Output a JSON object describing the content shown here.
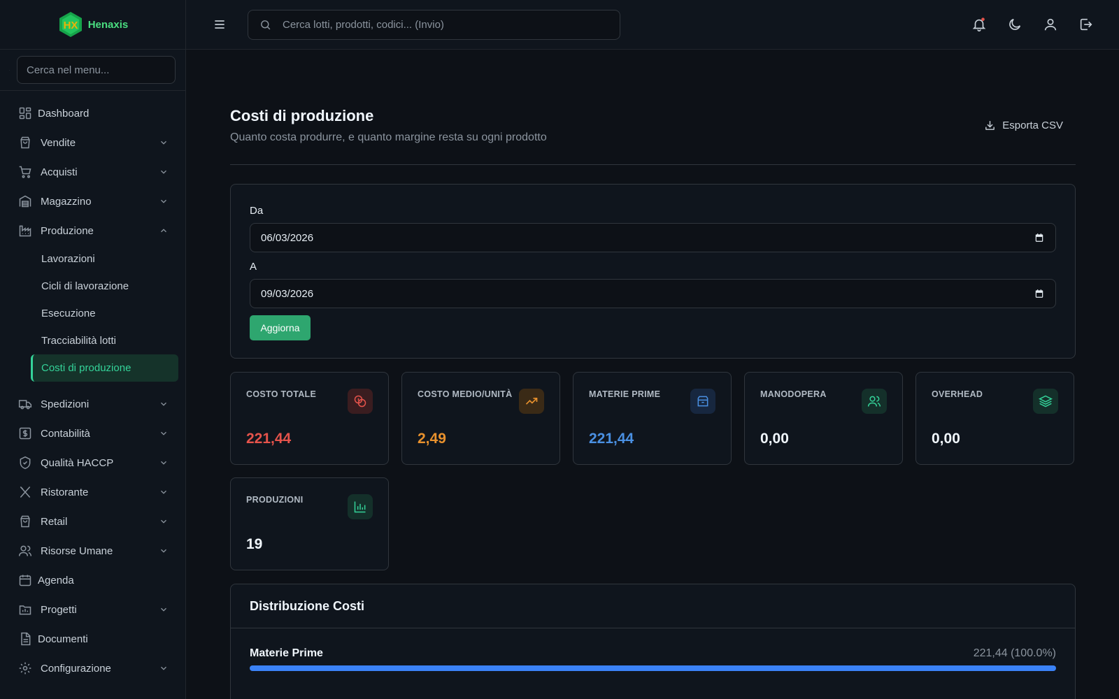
{
  "app": {
    "name": "Henaxis"
  },
  "sidebar": {
    "search_placeholder": "Cerca nel menu...",
    "items": [
      {
        "label": "Dashboard"
      },
      {
        "label": "Vendite"
      },
      {
        "label": "Acquisti"
      },
      {
        "label": "Magazzino"
      },
      {
        "label": "Produzione"
      },
      {
        "label": "Spedizioni"
      },
      {
        "label": "Contabilità"
      },
      {
        "label": "Qualità HACCP"
      },
      {
        "label": "Ristorante"
      },
      {
        "label": "Retail"
      },
      {
        "label": "Risorse Umane"
      },
      {
        "label": "Agenda"
      },
      {
        "label": "Progetti"
      },
      {
        "label": "Documenti"
      },
      {
        "label": "Configurazione"
      }
    ],
    "produzione_sub": [
      {
        "label": "Lavorazioni"
      },
      {
        "label": "Cicli di lavorazione"
      },
      {
        "label": "Esecuzione"
      },
      {
        "label": "Tracciabilità lotti"
      },
      {
        "label": "Costi di produzione"
      }
    ]
  },
  "topbar": {
    "search_placeholder": "Cerca lotti, prodotti, codici... (Invio)",
    "icons": [
      "menu-icon",
      "bell-icon",
      "moon-icon",
      "user-icon",
      "logout-icon"
    ]
  },
  "page": {
    "title": "Costi di produzione",
    "subtitle": "Quanto costa produrre, e quanto margine resta su ogni prodotto",
    "export_label": "Esporta CSV"
  },
  "filters": {
    "from_label": "Da",
    "from_value": "06/03/2026",
    "to_label": "A",
    "to_value": "09/03/2026",
    "refresh_label": "Aggiorna"
  },
  "stats": [
    {
      "label": "COSTO TOTALE",
      "value": "221,44",
      "color": "#e5534b",
      "icon": "coins-icon"
    },
    {
      "label": "COSTO MEDIO/UNITÀ",
      "value": "2,49",
      "color": "#e8912d",
      "icon": "trending-up-icon"
    },
    {
      "label": "MATERIE PRIME",
      "value": "221,44",
      "color": "#4a90e2",
      "icon": "package-icon"
    },
    {
      "label": "MANODOPERA",
      "value": "0,00",
      "color": "#f0f6fc",
      "icon": "users-icon"
    },
    {
      "label": "OVERHEAD",
      "value": "0,00",
      "color": "#f0f6fc",
      "icon": "layers-icon"
    },
    {
      "label": "PRODUZIONI",
      "value": "19",
      "color": "#f0f6fc",
      "icon": "bar-chart-icon"
    }
  ],
  "distribution": {
    "title": "Distribuzione Costi",
    "rows": [
      {
        "name": "Materie Prime",
        "value": "221,44 (100.0%)",
        "fraction": 1.0
      }
    ]
  },
  "colors": {
    "accent": "#34d399",
    "button": "#2ea66f",
    "bar": "#3b82f6",
    "background": "#0d1117"
  }
}
